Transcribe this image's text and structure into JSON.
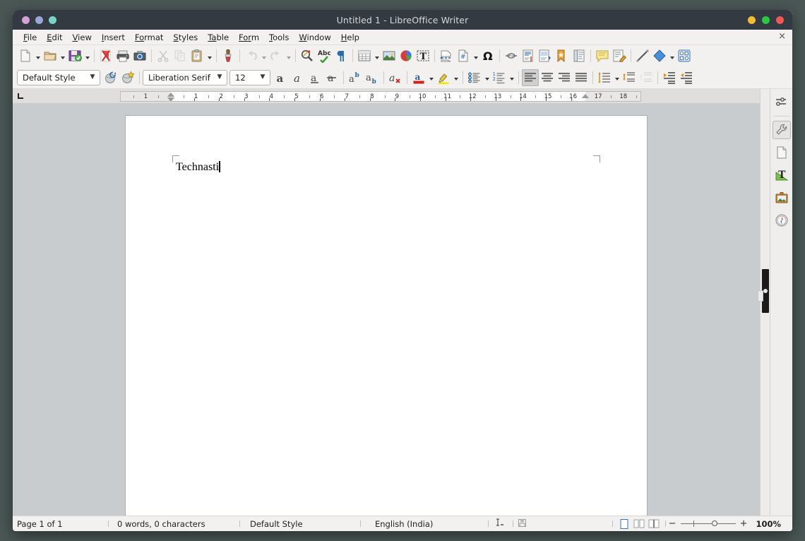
{
  "window": {
    "title": "Untitled 1 - LibreOffice Writer",
    "traffic_left": [
      "#d4a0d8",
      "#9aa8d8",
      "#79d3c8"
    ],
    "traffic_right": [
      "#f2bd2e",
      "#2ac940",
      "#f05750"
    ],
    "doc_close_label": "×"
  },
  "menubar": {
    "items": [
      {
        "name": "file",
        "pre": "F",
        "rest": "ile"
      },
      {
        "name": "edit",
        "pre": "E",
        "rest": "dit"
      },
      {
        "name": "view",
        "pre": "V",
        "rest": "iew"
      },
      {
        "name": "insert",
        "pre": "I",
        "rest": "nsert"
      },
      {
        "name": "format",
        "pre": "Fo",
        "rest": "rmat"
      },
      {
        "name": "styles",
        "pre": "S",
        "rest": "tyles"
      },
      {
        "name": "table",
        "pre": "Ta",
        "rest": "ble"
      },
      {
        "name": "form",
        "pre": "For",
        "rest": "m"
      },
      {
        "name": "tools",
        "pre": "T",
        "rest": "ools"
      },
      {
        "name": "window",
        "pre": "W",
        "rest": "indow"
      },
      {
        "name": "help",
        "pre": "H",
        "rest": "elp"
      }
    ]
  },
  "toolbar_standard": {
    "buttons": [
      {
        "name": "new-document-button",
        "icon": "new-doc-icon",
        "dropdown": true
      },
      {
        "name": "open-document-button",
        "icon": "open-folder-icon",
        "dropdown": true
      },
      {
        "name": "save-document-button",
        "icon": "save-disk-icon",
        "dropdown": true
      },
      {
        "sep": true
      },
      {
        "name": "export-pdf-button",
        "icon": "pdf-icon"
      },
      {
        "name": "print-button",
        "icon": "printer-icon"
      },
      {
        "name": "print-preview-button",
        "icon": "print-preview-icon"
      },
      {
        "sep": true
      },
      {
        "name": "cut-button",
        "icon": "scissors-icon",
        "disabled": true
      },
      {
        "name": "copy-button",
        "icon": "copy-icon",
        "disabled": true
      },
      {
        "name": "paste-button",
        "icon": "clipboard-icon",
        "dropdown": true
      },
      {
        "sep": true
      },
      {
        "name": "clone-formatting-button",
        "icon": "paintbrush-icon"
      },
      {
        "sep": true
      },
      {
        "name": "undo-button",
        "icon": "undo-arrow-icon",
        "dropdown": true,
        "disabled": true
      },
      {
        "name": "redo-button",
        "icon": "redo-arrow-icon",
        "dropdown": true,
        "disabled": true
      },
      {
        "sep": true
      },
      {
        "name": "find-replace-button",
        "icon": "find-replace-icon"
      },
      {
        "name": "spelling-button",
        "icon": "spellcheck-abc-icon"
      },
      {
        "name": "formatting-marks-button",
        "icon": "pilcrow-icon"
      },
      {
        "sep": true
      },
      {
        "name": "insert-table-button",
        "icon": "table-grid-icon",
        "dropdown": true
      },
      {
        "name": "insert-image-button",
        "icon": "image-icon"
      },
      {
        "name": "insert-chart-button",
        "icon": "pie-chart-icon"
      },
      {
        "name": "insert-text-box-button",
        "icon": "text-box-icon"
      },
      {
        "sep": true
      },
      {
        "name": "insert-page-break-button",
        "icon": "page-break-icon"
      },
      {
        "name": "insert-field-button",
        "icon": "field-hash-icon",
        "dropdown": true
      },
      {
        "name": "insert-special-character-button",
        "icon": "omega-icon"
      },
      {
        "sep": true
      },
      {
        "name": "insert-hyperlink-button",
        "icon": "hyperlink-icon"
      },
      {
        "name": "insert-footnote-button",
        "icon": "footnote-icon"
      },
      {
        "name": "insert-endnote-button",
        "icon": "endnote-icon"
      },
      {
        "name": "insert-bookmark-button",
        "icon": "bookmark-icon"
      },
      {
        "name": "insert-cross-reference-button",
        "icon": "cross-reference-icon"
      },
      {
        "sep": true
      },
      {
        "name": "insert-comment-button",
        "icon": "comment-note-icon"
      },
      {
        "name": "track-changes-button",
        "icon": "track-changes-icon"
      },
      {
        "sep": true
      },
      {
        "name": "insert-line-button",
        "icon": "line-icon"
      },
      {
        "name": "basic-shapes-button",
        "icon": "diamond-shape-icon",
        "dropdown": true
      },
      {
        "name": "show-draw-functions-button",
        "icon": "draw-functions-icon"
      }
    ]
  },
  "toolbar_format": {
    "paragraph_style": "Default Style",
    "font_name": "Liberation Serif",
    "font_size": "12",
    "buttons": [
      {
        "name": "update-style-button",
        "icon": "update-style-icon"
      },
      {
        "name": "new-style-button",
        "icon": "new-style-icon"
      },
      {
        "sep": true
      },
      {
        "name": "bold-button",
        "icon": "bold-a-icon"
      },
      {
        "name": "italic-button",
        "icon": "italic-a-icon"
      },
      {
        "name": "underline-button",
        "icon": "underline-a-icon"
      },
      {
        "name": "strikethrough-button",
        "icon": "strikethrough-a-icon"
      },
      {
        "sep": true
      },
      {
        "name": "superscript-button",
        "icon": "superscript-icon"
      },
      {
        "name": "subscript-button",
        "icon": "subscript-icon"
      },
      {
        "sep": true
      },
      {
        "name": "clear-formatting-button",
        "icon": "clear-formatting-icon"
      },
      {
        "sep": true
      },
      {
        "name": "font-color-button",
        "icon": "font-color-icon",
        "dropdown": true
      },
      {
        "name": "highlight-color-button",
        "icon": "highlight-color-icon",
        "dropdown": true
      },
      {
        "sep": true
      },
      {
        "name": "unordered-list-button",
        "icon": "bullet-list-icon",
        "dropdown": true
      },
      {
        "name": "ordered-list-button",
        "icon": "numbered-list-icon",
        "dropdown": true
      },
      {
        "sep": true
      },
      {
        "name": "align-left-button",
        "icon": "align-left-icon",
        "active": true
      },
      {
        "name": "align-center-button",
        "icon": "align-center-icon"
      },
      {
        "name": "align-right-button",
        "icon": "align-right-icon"
      },
      {
        "name": "align-justified-button",
        "icon": "align-justify-icon"
      },
      {
        "sep": true
      },
      {
        "name": "line-spacing-button",
        "icon": "line-spacing-icon",
        "dropdown": true
      },
      {
        "name": "increase-paragraph-spacing-button",
        "icon": "increase-para-spacing-icon"
      },
      {
        "name": "decrease-paragraph-spacing-button",
        "icon": "decrease-para-spacing-icon",
        "disabled": true
      },
      {
        "sep": true
      },
      {
        "name": "increase-indent-button",
        "icon": "increase-indent-icon"
      },
      {
        "name": "decrease-indent-button",
        "icon": "decrease-indent-icon"
      }
    ]
  },
  "ruler": {
    "unit": "inch",
    "left_labels": [
      "1"
    ],
    "labels": [
      "1",
      "2",
      "3",
      "4",
      "5",
      "6",
      "7",
      "8",
      "9",
      "10",
      "11",
      "12",
      "13",
      "14",
      "15",
      "16",
      "17",
      "18"
    ],
    "left_indent_in": 0,
    "right_indent_in": 16.5,
    "tab_stops_in": [
      1,
      2,
      3,
      4,
      5,
      6,
      7,
      8,
      9,
      10,
      11,
      12,
      13,
      14,
      15,
      16
    ]
  },
  "document": {
    "text": "Technasti",
    "page_label": "page-1"
  },
  "sidebar": {
    "items": [
      {
        "name": "sidebar-settings-button",
        "icon": "sidebar-settings-icon"
      },
      {
        "name": "sidebar-properties-button",
        "icon": "wrench-icon",
        "selected": true
      },
      {
        "name": "sidebar-page-button",
        "icon": "page-icon"
      },
      {
        "name": "sidebar-styles-button",
        "icon": "styles-t-icon"
      },
      {
        "name": "sidebar-gallery-button",
        "icon": "gallery-picture-icon"
      },
      {
        "name": "sidebar-navigator-button",
        "icon": "navigator-compass-icon"
      }
    ]
  },
  "statusbar": {
    "page": "Page 1 of 1",
    "words": "0 words, 0 characters",
    "style": "Default Style",
    "language": "English (India)",
    "selection_mode_icon": "text-selection-icon",
    "save_state_icon": "save-state-icon",
    "views": [
      {
        "name": "single-page-view-button",
        "icon": "single-page-icon",
        "active": true
      },
      {
        "name": "multi-page-view-button",
        "icon": "multi-page-icon"
      },
      {
        "name": "book-view-button",
        "icon": "book-view-icon"
      }
    ],
    "zoom_out_label": "−",
    "zoom_in_label": "+",
    "zoom": "100%"
  }
}
